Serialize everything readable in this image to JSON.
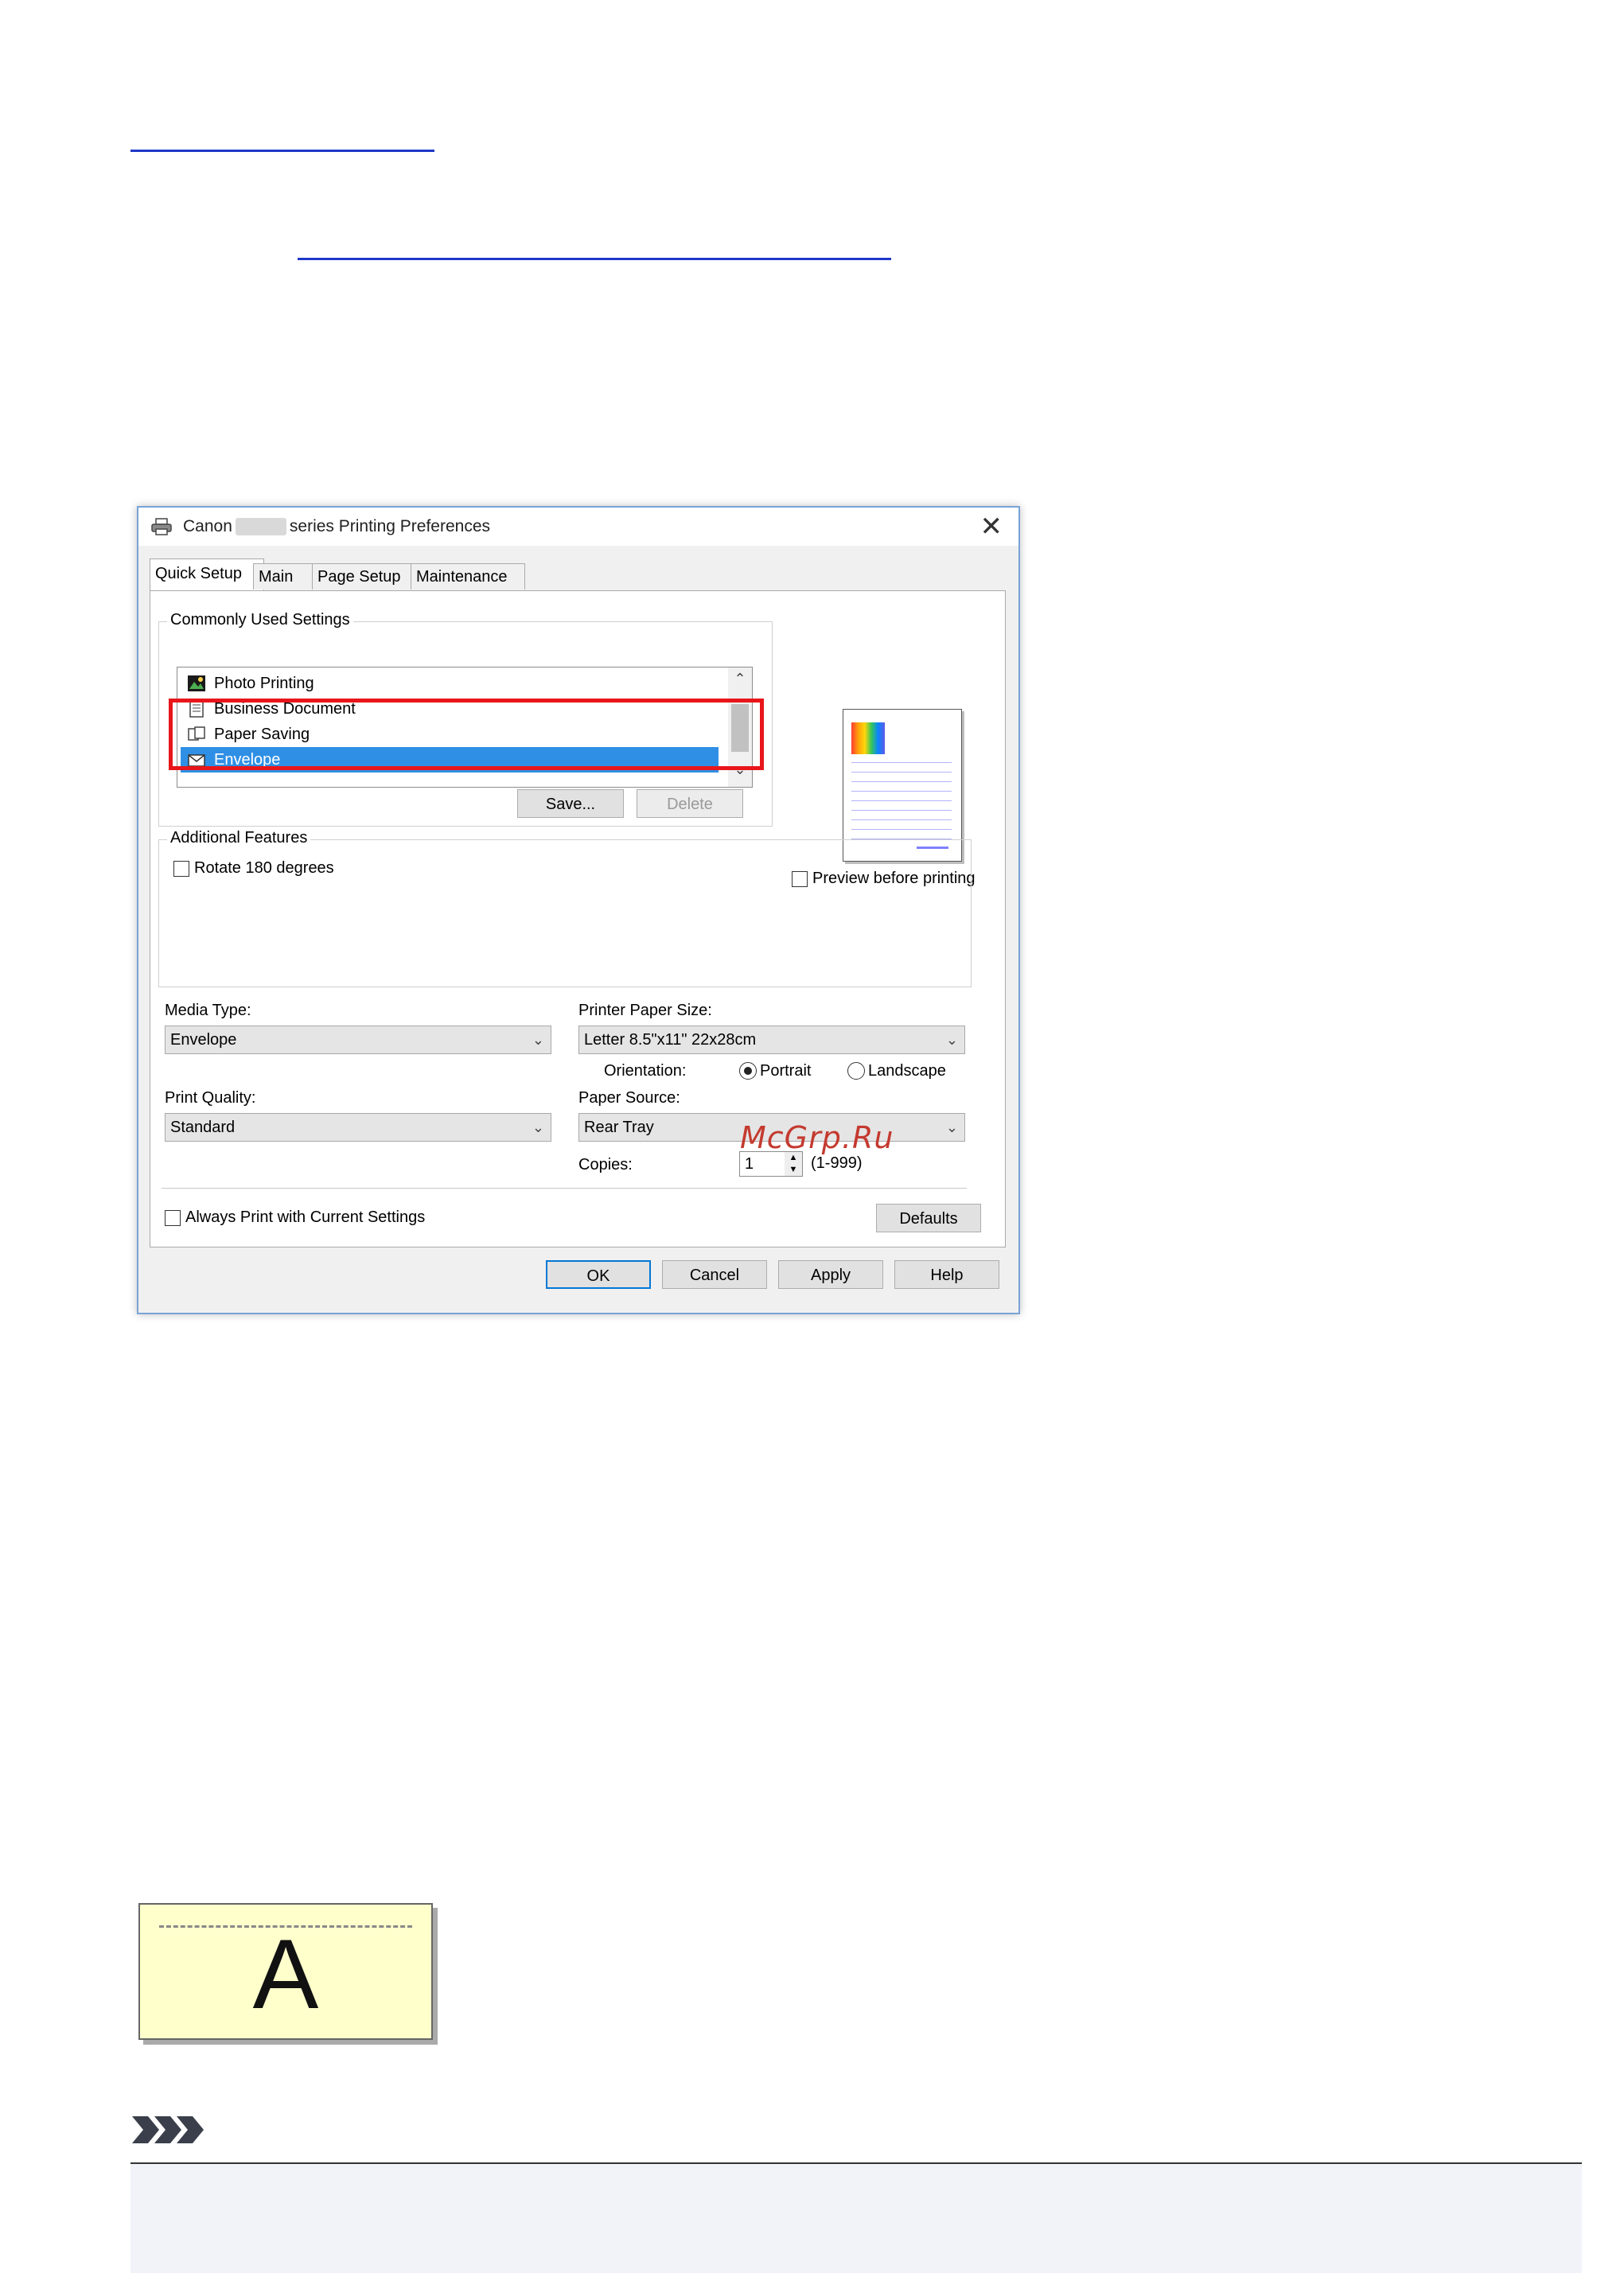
{
  "watermark": "McGrp.Ru",
  "dialog": {
    "title_prefix": "Canon",
    "title_suffix": "series Printing Preferences",
    "close_glyph": "✕",
    "tabs": [
      {
        "label": "Quick Setup",
        "active": true
      },
      {
        "label": "Main",
        "active": false
      },
      {
        "label": "Page Setup",
        "active": false
      },
      {
        "label": "Maintenance",
        "active": false
      }
    ],
    "commonly_used": {
      "label": "Commonly Used Settings",
      "items": [
        {
          "label": "Photo Printing",
          "icon": "photo-icon",
          "selected": false
        },
        {
          "label": "Business Document",
          "icon": "document-icon",
          "selected": false
        },
        {
          "label": "Paper Saving",
          "icon": "paper-saving-icon",
          "selected": false
        },
        {
          "label": "Envelope",
          "icon": "envelope-icon",
          "selected": true
        }
      ],
      "save_label": "Save...",
      "delete_label": "Delete"
    },
    "preview_label": "Preview before printing",
    "additional_features": {
      "label": "Additional Features",
      "rotate_label": "Rotate 180 degrees"
    },
    "media_type": {
      "label": "Media Type:",
      "value": "Envelope"
    },
    "printer_paper_size": {
      "label": "Printer Paper Size:",
      "value": "Letter 8.5\"x11\" 22x28cm"
    },
    "orientation": {
      "label": "Orientation:",
      "portrait": "Portrait",
      "landscape": "Landscape",
      "selected": "Portrait"
    },
    "print_quality": {
      "label": "Print Quality:",
      "value": "Standard"
    },
    "paper_source": {
      "label": "Paper Source:",
      "value": "Rear Tray"
    },
    "copies": {
      "label": "Copies:",
      "value": "1",
      "range": "(1-999)"
    },
    "always_print_label": "Always Print with Current Settings",
    "defaults_label": "Defaults",
    "buttons": {
      "ok": "OK",
      "cancel": "Cancel",
      "apply": "Apply",
      "help": "Help"
    }
  },
  "envelope_letter": "A",
  "colors": {
    "link": "#1f38c8",
    "highlight": "#e8161b",
    "selection": "#2f8fe5",
    "envelope_fill": "#ffffcc"
  }
}
